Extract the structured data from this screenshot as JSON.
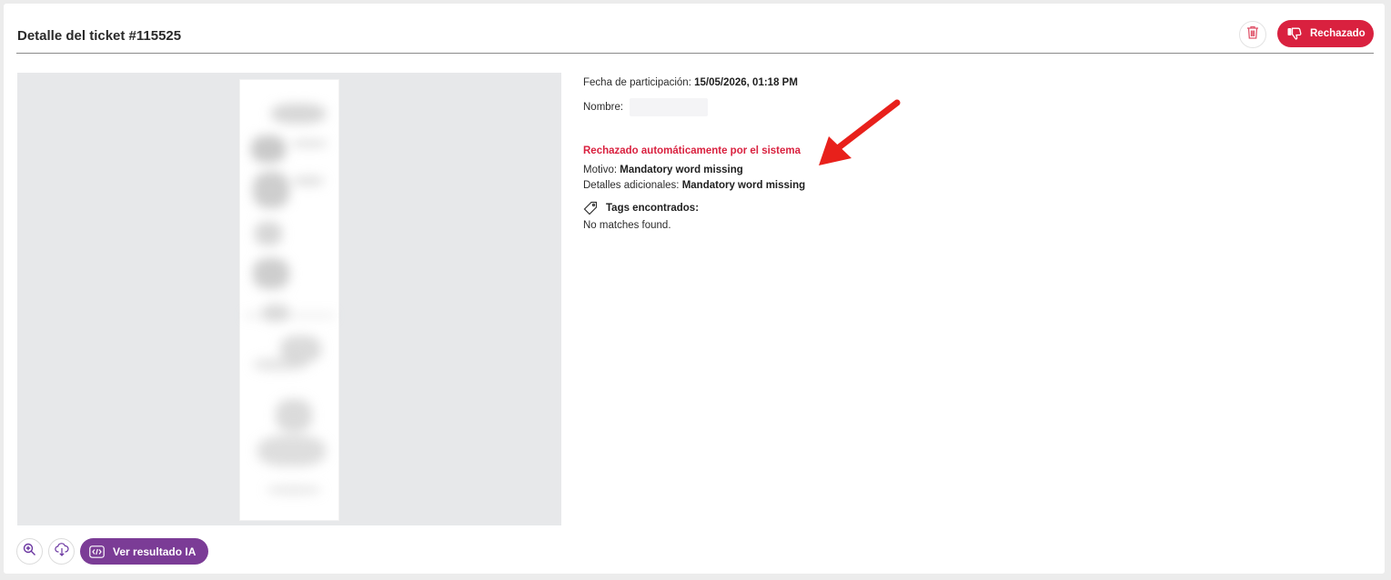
{
  "header": {
    "title": "Detalle del ticket #115525",
    "status_label": "Rechazado"
  },
  "viewer": {
    "ai_button_label": "Ver resultado IA"
  },
  "details": {
    "date_label": "Fecha de participación:",
    "date_value": "15/05/2026, 01:18 PM",
    "name_label": "Nombre:",
    "rejected_text": "Rechazado automáticamente por el sistema",
    "reason_label": "Motivo:",
    "reason_value": "Mandatory word missing",
    "extra_label": "Detalles adicionales:",
    "extra_value": "Mandatory word missing",
    "tags_label": "Tags encontrados:",
    "tags_value": "No matches found."
  },
  "colors": {
    "danger": "#d9213f",
    "ai_purple": "#7b3c96",
    "annotation_arrow": "#e8201b"
  },
  "icons": [
    "trash-icon",
    "thumbs-down-icon",
    "zoom-in-icon",
    "cloud-download-icon",
    "code-icon",
    "tag-icon",
    "arrow-annotation"
  ]
}
